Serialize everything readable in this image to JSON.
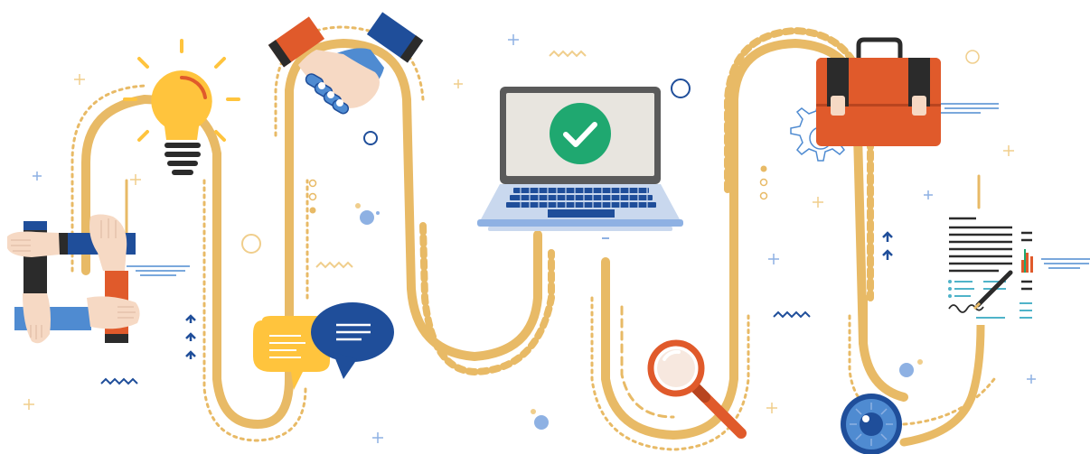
{
  "illustration": {
    "kind": "business-process-roadmap",
    "colors": {
      "path_gold": "#E8BA66",
      "path_gold_light": "#F0CE8C",
      "navy": "#1F4E9A",
      "blue": "#4F8BD1",
      "light_blue": "#8EB1E3",
      "orange": "#E05A2B",
      "yellow": "#FFC43D",
      "green": "#1FA870",
      "dark": "#2B2B2B",
      "skin": "#F6D9C4",
      "screen_bg": "#E8E5DF",
      "laptop_frame": "#5A5A5A",
      "gray_line": "#C9C9C9"
    },
    "stages": [
      {
        "id": "teamwork",
        "icon": "hands-circle-icon"
      },
      {
        "id": "idea",
        "icon": "lightbulb-icon"
      },
      {
        "id": "agreement",
        "icon": "handshake-icon"
      },
      {
        "id": "discussion",
        "icon": "speech-bubbles-icon"
      },
      {
        "id": "approval",
        "icon": "laptop-checkmark-icon"
      },
      {
        "id": "research",
        "icon": "magnifier-icon"
      },
      {
        "id": "business",
        "icon": "briefcase-icon"
      },
      {
        "id": "settings",
        "icon": "gear-icon"
      },
      {
        "id": "vision",
        "icon": "eye-icon"
      },
      {
        "id": "contract",
        "icon": "signed-document-icon"
      }
    ]
  }
}
